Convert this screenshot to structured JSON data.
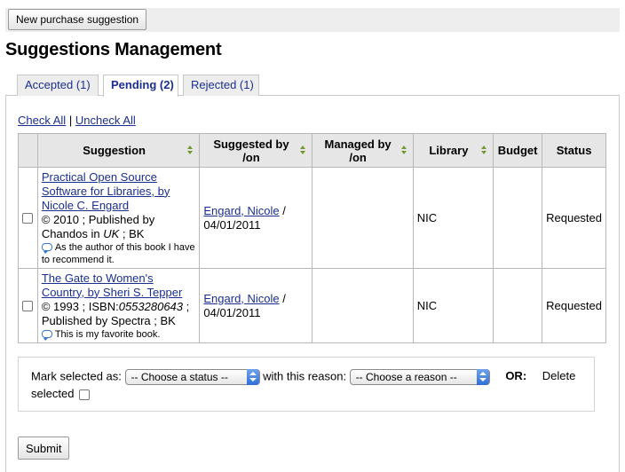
{
  "toolbar": {
    "new_button": "New purchase suggestion"
  },
  "page_title": "Suggestions Management",
  "tabs": [
    {
      "label": "Accepted (1)",
      "active": false
    },
    {
      "label": "Pending (2)",
      "active": true
    },
    {
      "label": "Rejected (1)",
      "active": false
    }
  ],
  "check_links": {
    "check_all": "Check All",
    "separator": "|",
    "uncheck_all": "Uncheck All"
  },
  "table": {
    "headers": {
      "suggestion": "Suggestion",
      "suggested_by": "Suggested by /on",
      "managed_by": "Managed by /on",
      "library": "Library",
      "budget": "Budget",
      "status": "Status"
    },
    "rows": [
      {
        "title": "Practical Open Source Software for Libraries, by Nicole C. Engard",
        "details_pre": "© 2010 ; Published by Chandos in ",
        "details_em": "UK",
        "details_post": " ; BK",
        "note": "As the author of this book I have to recommend it.",
        "suggested_by": "Engard, Nicole",
        "suggested_sep": " /",
        "suggested_on": "04/01/2011",
        "managed": "",
        "library": "NIC",
        "budget": "",
        "status": "Requested"
      },
      {
        "title": "The Gate to Women's Country, by Sheri S. Tepper",
        "details_pre": "© 1993 ; ISBN:",
        "details_em": "0553280643",
        "details_post": " ; Published by Spectra ; BK",
        "note": "This is my favorite book.",
        "suggested_by": "Engard, Nicole",
        "suggested_sep": " /",
        "suggested_on": "04/01/2011",
        "managed": "",
        "library": "NIC",
        "budget": "",
        "status": "Requested"
      }
    ]
  },
  "actions": {
    "mark_label": "Mark selected as:",
    "status_select": "-- Choose a status --",
    "reason_label": "with this reason:",
    "reason_select": "-- Choose a reason --",
    "or_label": "OR:",
    "delete_word": "Delete",
    "selected_word": "selected"
  },
  "submit_button": "Submit",
  "colors": {
    "link": "#1a2f8f",
    "sort_arrow": "#6d9a2e",
    "select_accent": "#2f6fd6"
  },
  "icons": {
    "note": "speech-bubble-icon",
    "sort": "sort-arrows-icon",
    "select": "select-arrows-icon"
  }
}
